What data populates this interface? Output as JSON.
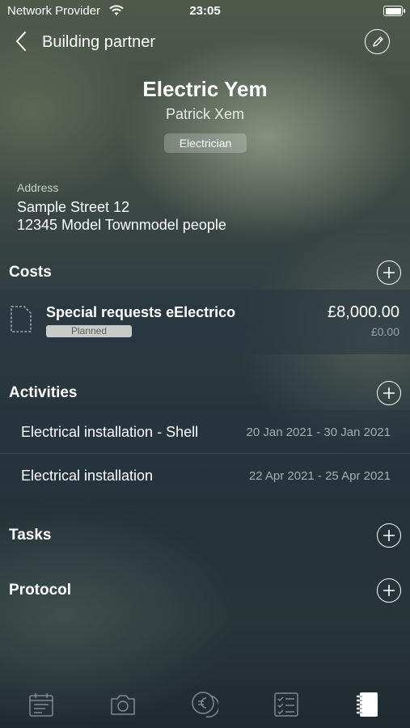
{
  "status": {
    "carrier": "Network Provider",
    "time": "23:05"
  },
  "nav": {
    "title": "Building partner",
    "back_icon": "chevron-left-icon",
    "edit_icon": "pencil-icon"
  },
  "partner": {
    "company": "Electric Yem",
    "person": "Patrick Xem",
    "role": "Electrician",
    "address_label": "Address",
    "address_line1": "Sample Street 12",
    "address_line2": "12345 Model Townmodel people"
  },
  "costs": {
    "title": "Costs",
    "items": [
      {
        "name": "Special requests eElectrico",
        "status": "Planned",
        "amount": "£8,000.00",
        "paid": "£0.00"
      }
    ]
  },
  "activities": {
    "title": "Activities",
    "items": [
      {
        "name": "Electrical installation - Shell",
        "dates": "20 Jan 2021 - 30 Jan 2021"
      },
      {
        "name": "Electrical installation",
        "dates": "22 Apr 2021 - 25 Apr 2021"
      }
    ]
  },
  "tasks": {
    "title": "Tasks"
  },
  "protocol": {
    "title": "Protocol"
  },
  "tabbar": {
    "tabs": [
      "schedule-icon",
      "camera-icon",
      "euro-icon",
      "checklist-icon",
      "notebook-icon"
    ],
    "active": "notebook-icon"
  },
  "colors": {
    "text_primary": "#ffffff",
    "text_secondary": "#a4aeb1",
    "planned_badge": "#c8cbc8"
  }
}
